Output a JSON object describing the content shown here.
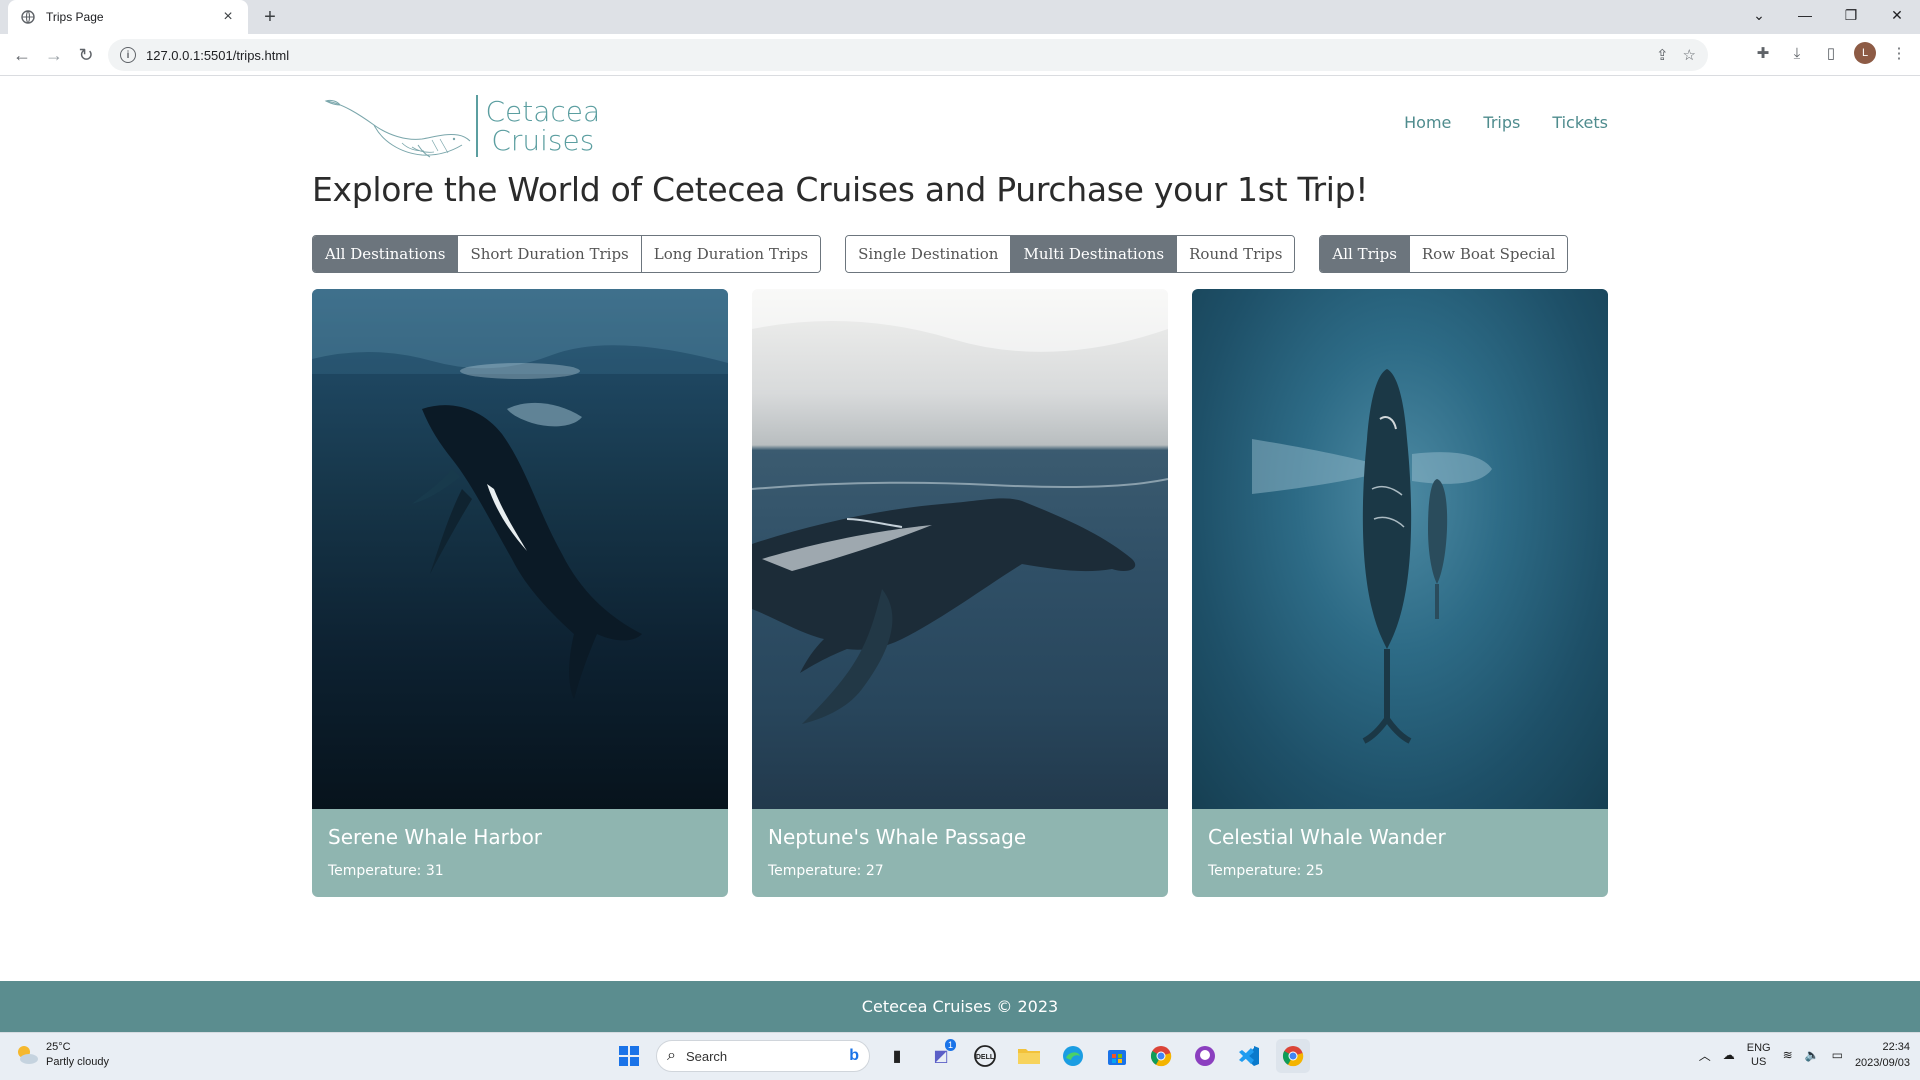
{
  "browser": {
    "tab_title": "Trips Page",
    "url": "127.0.0.1:5501/trips.html",
    "avatar_letter": "L"
  },
  "site": {
    "logo_line1": "Cetacea",
    "logo_line2": "Cruises",
    "nav": [
      "Home",
      "Trips",
      "Tickets"
    ],
    "title": "Explore the World of Cetecea Cruises and Purchase your 1st Trip!",
    "filter_groups": [
      {
        "buttons": [
          "All Destinations",
          "Short Duration Trips",
          "Long Duration Trips"
        ],
        "active": "All Destinations"
      },
      {
        "buttons": [
          "Single Destination",
          "Multi Destinations",
          "Round Trips"
        ],
        "active": "Multi Destinations"
      },
      {
        "buttons": [
          "All Trips",
          "Row Boat Special"
        ],
        "active": "All Trips"
      }
    ],
    "cards": [
      {
        "title": "Serene Whale Harbor",
        "temperature": "Temperature: 31"
      },
      {
        "title": "Neptune's Whale Passage",
        "temperature": "Temperature: 27"
      },
      {
        "title": "Celestial Whale Wander",
        "temperature": "Temperature: 25"
      }
    ],
    "footer": "Cetecea Cruises © 2023"
  },
  "taskbar": {
    "weather_temp": "25°C",
    "weather_desc": "Partly cloudy",
    "search_label": "Search",
    "lang_top": "ENG",
    "lang_bottom": "US",
    "time": "22:34",
    "date": "2023/09/03",
    "notification_badge": "1"
  },
  "colors": {
    "accent": "#5b9ea0",
    "card_body": "#8fb5b0",
    "footer": "#5b8d8f",
    "active_button": "#6c757d"
  }
}
